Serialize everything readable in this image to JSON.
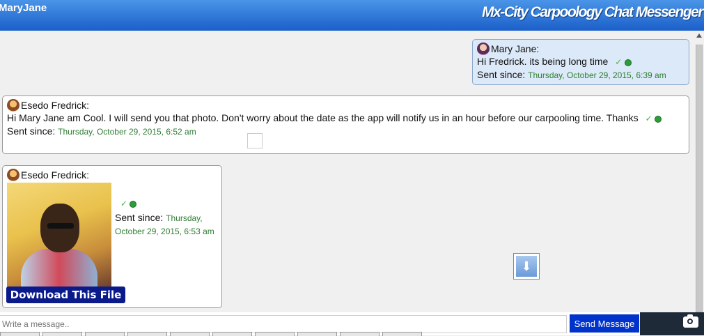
{
  "header": {
    "user": "MaryJane",
    "title": "Mx-City Carpoology Chat Messenger"
  },
  "messages": [
    {
      "sender": "Mary Jane:",
      "text": "Hi Fredrick. its being long time",
      "sent_label": "Sent since:",
      "time": "Thursday, October 29, 2015, 6:39 am",
      "status": "✓"
    },
    {
      "sender": "Esedo Fredrick:",
      "text": "Hi Mary Jane am Cool. I will send you that photo. Don't worry about the date as the app will notify us in an hour before our carpooling time. Thanks",
      "sent_label": "Sent since:",
      "time": "Thursday, October 29, 2015, 6:52 am",
      "status": "✓"
    },
    {
      "sender": "Esedo Fredrick:",
      "sent_label": "Sent since:",
      "time": "Thursday, October 29, 2015, 6:53 am",
      "status": "✓",
      "download_label": "Download This File"
    }
  ],
  "composer": {
    "placeholder": "Write a message..",
    "send_label": "Send Message"
  },
  "icons": {
    "scroll_down": "arrow-down-icon",
    "camera": "camera-icon"
  },
  "colors": {
    "header": "#1b5fc9",
    "send_button": "#0033cc",
    "download_button": "#0a1a8a",
    "timestamp": "#2e7d32"
  }
}
